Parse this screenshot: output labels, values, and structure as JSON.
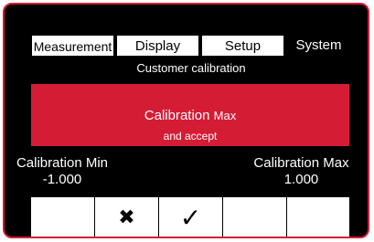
{
  "tabs": [
    {
      "label": "Measurement",
      "selected": false
    },
    {
      "label": "Display",
      "selected": false
    },
    {
      "label": "Setup",
      "selected": false
    },
    {
      "label": "System",
      "selected": true
    }
  ],
  "subtitle": "Customer calibration",
  "banner": {
    "title": "Calibration",
    "title_unit": "Max",
    "subtitle": "and accept"
  },
  "calibration_min": {
    "label": "Calibration Min",
    "value": "-1.000"
  },
  "calibration_max": {
    "label": "Calibration Max",
    "value": "1.000"
  },
  "softkeys": [
    {
      "icon": "",
      "name": "softkey-1"
    },
    {
      "icon": "cross-icon",
      "glyph": "✖"
    },
    {
      "icon": "check-icon",
      "glyph": "✓"
    },
    {
      "icon": "",
      "name": "softkey-4"
    },
    {
      "icon": "",
      "name": "softkey-5"
    }
  ],
  "colors": {
    "accent": "#d41c35",
    "background": "#000000",
    "frame": "#d41c35"
  }
}
